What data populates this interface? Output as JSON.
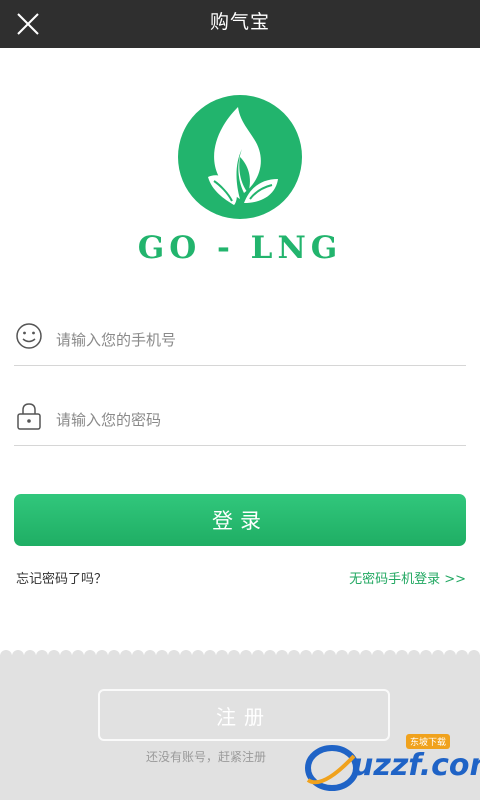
{
  "header": {
    "title": "购气宝",
    "close_icon": "close-icon"
  },
  "brand": {
    "logo_icon": "leaf-flame-logo",
    "logo_color": "#22b46d",
    "name": "GO - LNG"
  },
  "form": {
    "phone": {
      "icon": "smiley-icon",
      "placeholder": "请输入您的手机号",
      "value": ""
    },
    "password": {
      "icon": "lock-icon",
      "placeholder": "请输入您的密码",
      "value": ""
    },
    "login_label": "登录",
    "forgot_label": "忘记密码了吗？",
    "no_password_login_label": "无密码手机登录 >>"
  },
  "footer": {
    "register_label": "注册",
    "hint": "还没有账号，赶紧注册"
  },
  "watermark": {
    "text": "uzzf.com",
    "badge": "东坡下载"
  },
  "colors": {
    "accent": "#22b46d",
    "header_bg": "#2f2f2f",
    "footer_bg": "#e1e1e1"
  }
}
